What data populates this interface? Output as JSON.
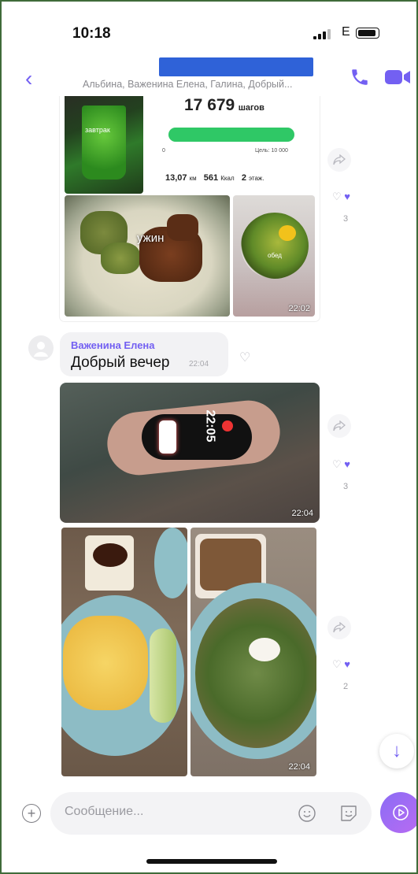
{
  "status": {
    "time": "10:18",
    "network": "E"
  },
  "header": {
    "subtitle": "Альбина, Важенина Елена, Галина, Добрый..."
  },
  "step_card": {
    "steps": "17 679",
    "steps_unit": "шагов",
    "progress_fraction": 1.0,
    "bar_start": "0",
    "bar_goal": "Цель: 10 000",
    "distance": "13,07",
    "distance_unit": "км",
    "calories": "561",
    "calories_unit": "Ккал",
    "floors": "2",
    "floors_unit": "этаж.",
    "juice_caption": "завтрак",
    "dinner_caption": "ужин",
    "lunch_caption": "обед",
    "time": "22:02",
    "reactions_count": "3"
  },
  "message": {
    "sender": "Важенина Елена",
    "text": "Добрый вечер",
    "time": "22:04"
  },
  "bracelet_photo": {
    "time": "22:04",
    "reactions_count": "3",
    "watch_digits": "22:05"
  },
  "food_photos": {
    "time": "22:04",
    "reactions_count": "2"
  },
  "composer": {
    "placeholder": "Сообщение..."
  },
  "colors": {
    "accent": "#7360f2",
    "progress": "#2fc866",
    "redaction": "#2f62d8"
  }
}
